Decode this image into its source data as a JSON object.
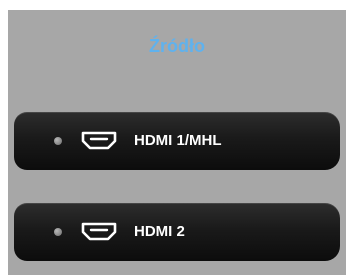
{
  "menu": {
    "title": "Źródło"
  },
  "sources": [
    {
      "label": "HDMI 1/MHL",
      "icon": "hdmi-port-icon"
    },
    {
      "label": "HDMI 2",
      "icon": "hdmi-port-icon"
    }
  ],
  "colors": {
    "panel_background": "#a7a7a7",
    "title": "#5fb2ee",
    "button": "#1a1a1a",
    "label": "#ffffff"
  }
}
